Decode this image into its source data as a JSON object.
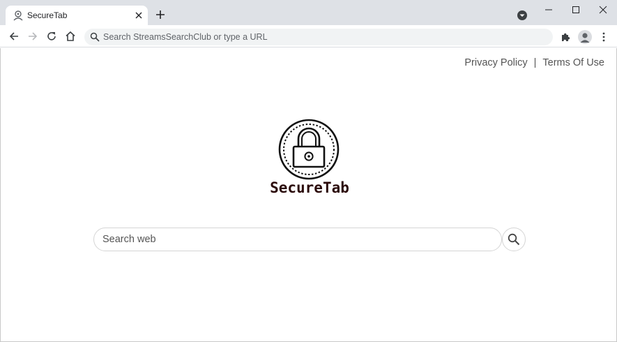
{
  "browser": {
    "tab_title": "SecureTab",
    "omnibox_placeholder": "Search StreamsSearchClub or type a URL"
  },
  "page": {
    "links": {
      "privacy": "Privacy Policy",
      "separator": "|",
      "terms": "Terms Of Use"
    },
    "brand_name": "SecureTab",
    "search": {
      "placeholder": "Search web",
      "value": ""
    }
  },
  "colors": {
    "chrome_bg": "#dee1e6",
    "omnibox_bg": "#f1f3f4",
    "brand_text": "#2b0a0a",
    "link_text": "#555555"
  },
  "icons": {
    "tab_favicon": "user-shield-icon",
    "search_button": "magnifier-icon"
  }
}
